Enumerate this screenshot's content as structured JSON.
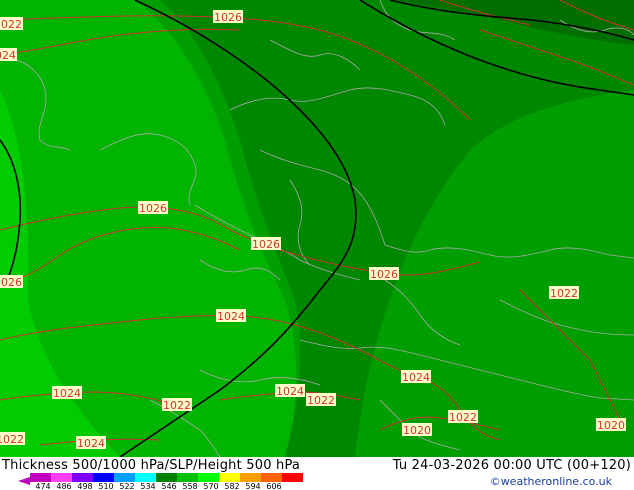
{
  "map": {
    "pressure_labels": [
      {
        "text": "1026"
      },
      {
        "text": "1022"
      },
      {
        "text": "1024"
      },
      {
        "text": "1026"
      },
      {
        "text": "1026"
      },
      {
        "text": "1026"
      },
      {
        "text": "1026"
      },
      {
        "text": "1024"
      },
      {
        "text": "1022"
      },
      {
        "text": "1024"
      },
      {
        "text": "1022"
      },
      {
        "text": "1024"
      },
      {
        "text": "1022"
      },
      {
        "text": "1024"
      },
      {
        "text": "1022"
      },
      {
        "text": "1024"
      },
      {
        "text": "1022"
      },
      {
        "text": "1020"
      },
      {
        "text": "1020"
      }
    ],
    "colors": {
      "ocean_shelf": "#00cc00",
      "green_542": "#00b400",
      "green_546": "#009e00",
      "green_550": "#008700",
      "green_554": "#006f00",
      "isobar": "#cc3333",
      "height_contour": "#000000",
      "border": "#aaaaaa"
    }
  },
  "footer": {
    "title_left": "Thickness 500/1000 hPa/SLP/Height 500 hPa",
    "title_right": "Tu 24-03-2026 00:00 UTC (00+120)",
    "credit": "©weatheronline.co.uk"
  },
  "colorbar": {
    "ticks": [
      "474",
      "486",
      "498",
      "510",
      "522",
      "534",
      "546",
      "558",
      "570",
      "582",
      "594",
      "606"
    ],
    "colors": [
      "#c000c0",
      "#ff40ff",
      "#8000ff",
      "#0000ff",
      "#00a0ff",
      "#00ffff",
      "#008000",
      "#00c000",
      "#00ff00",
      "#ffff00",
      "#ffa000",
      "#ff6000",
      "#ff0000"
    ]
  }
}
